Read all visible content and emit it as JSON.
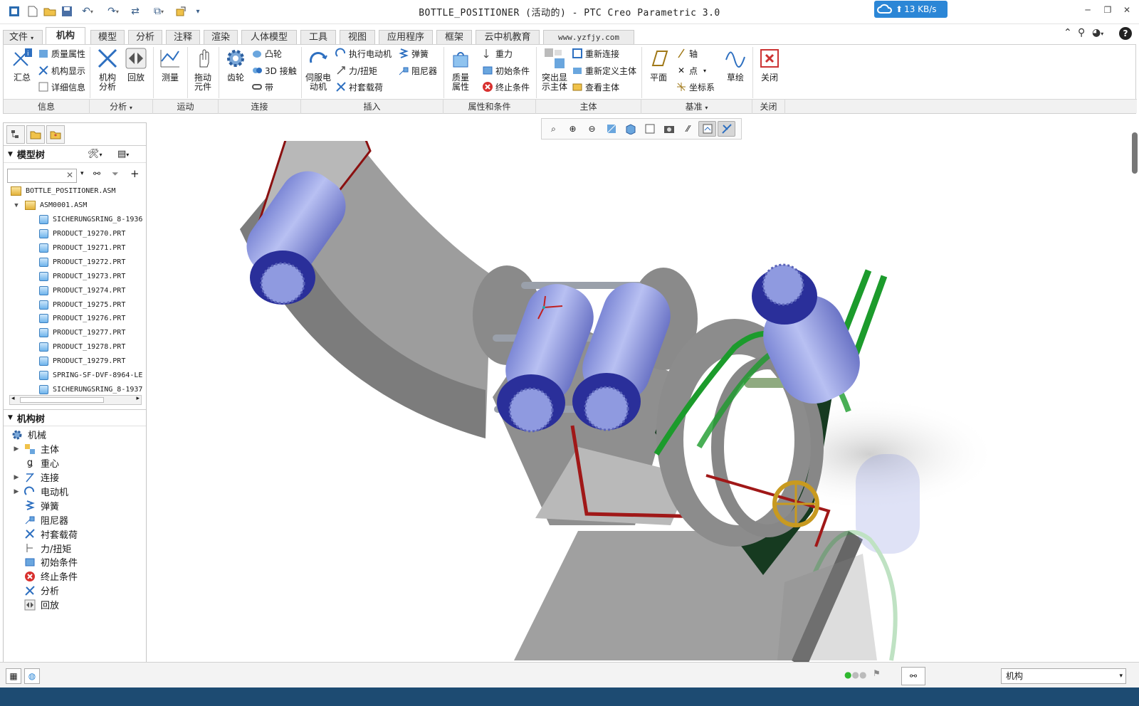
{
  "window": {
    "title": "BOTTLE_POSITIONER (活动的) - PTC Creo Parametric 3.0",
    "net_speed": "13 KB/s"
  },
  "tabs": [
    {
      "label": "文件",
      "active": false
    },
    {
      "label": "机构",
      "active": true
    },
    {
      "label": "模型",
      "active": false
    },
    {
      "label": "分析",
      "active": false
    },
    {
      "label": "注释",
      "active": false
    },
    {
      "label": "渲染",
      "active": false
    },
    {
      "label": "人体模型",
      "active": false
    },
    {
      "label": "工具",
      "active": false
    },
    {
      "label": "视图",
      "active": false
    },
    {
      "label": "应用程序",
      "active": false
    },
    {
      "label": "框架",
      "active": false
    },
    {
      "label": "云中机教育",
      "active": false
    },
    {
      "label": "www.yzfjy.com",
      "active": false
    }
  ],
  "ribbon": {
    "info": {
      "summary": "汇总",
      "mass_props": "质量属性",
      "mech_display": "机构显示",
      "details": "详细信息",
      "group": "信息"
    },
    "analysis": {
      "mech_analysis": "机构\n分析",
      "playback": "回放",
      "group": "分析"
    },
    "motion": {
      "measure": "测量",
      "drag": "拖动\n元件",
      "group": "运动"
    },
    "connect": {
      "gear": "齿轮",
      "cam": "凸轮",
      "contact3d": "3D 接触",
      "belt": "带",
      "group": "连接"
    },
    "insert": {
      "servo": "伺服电\n动机",
      "exec_motor": "执行电动机",
      "force_torque": "力/扭矩",
      "bushing": "衬套载荷",
      "spring": "弹簧",
      "damper": "阻尼器",
      "group": "插入"
    },
    "props": {
      "mass_props": "质量\n属性",
      "gravity": "重力",
      "initial": "初始条件",
      "terminate": "终止条件",
      "group": "属性和条件"
    },
    "body": {
      "highlight": "突出显\n示主体",
      "reconnect": "重新连接",
      "redefine": "重新定义主体",
      "view_body": "查看主体",
      "group": "主体"
    },
    "datum": {
      "plane": "平面",
      "axis": "轴",
      "point": "点",
      "csys": "坐标系",
      "sketch": "草绘",
      "group": "基准"
    },
    "close": {
      "label": "关闭",
      "group": "关闭"
    }
  },
  "model_tree": {
    "header": "模型树",
    "root": "BOTTLE_POSITIONER.ASM",
    "asm": "ASM0001.ASM",
    "items": [
      "SICHERUNGSRING_8-1936",
      "PRODUCT_19270.PRT",
      "PRODUCT_19271.PRT",
      "PRODUCT_19272.PRT",
      "PRODUCT_19273.PRT",
      "PRODUCT_19274.PRT",
      "PRODUCT_19275.PRT",
      "PRODUCT_19276.PRT",
      "PRODUCT_19277.PRT",
      "PRODUCT_19278.PRT",
      "PRODUCT_19279.PRT",
      "SPRING-SF-DVF-8964-LE",
      "SICHERUNGSRING_8-1937"
    ]
  },
  "mech_tree": {
    "header": "机构树",
    "root": "机械",
    "items": [
      "主体",
      "重心",
      "连接",
      "电动机",
      "弹簧",
      "阻尼器",
      "衬套载荷",
      "力/扭矩",
      "初始条件",
      "终止条件",
      "分析",
      "回放"
    ]
  },
  "status": {
    "filter": "机构"
  },
  "colors": {
    "accent": "#2b86d6",
    "bottle": "#8f9ae0",
    "cap": "#2a2f9a",
    "frame": "#8c8c8c",
    "red": "#a01818",
    "green": "#1c9b2c"
  }
}
